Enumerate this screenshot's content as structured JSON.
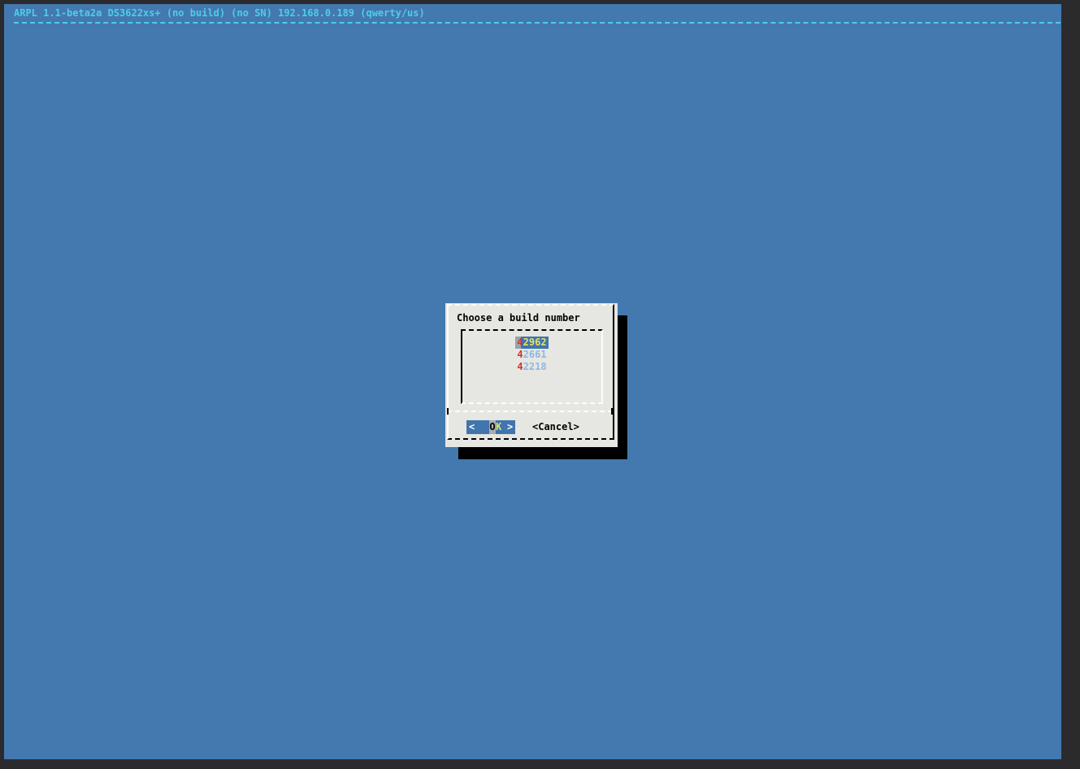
{
  "terminal": {
    "backtitle": "ARPL 1.1-beta2a DS3622xs+ (no build) (no SN) 192.168.0.189 (qwerty/us)"
  },
  "dialog": {
    "title": "Choose a build number",
    "items": [
      {
        "hotkey": "4",
        "rest": "2962",
        "selected": true
      },
      {
        "hotkey": "4",
        "rest": "2661",
        "selected": false
      },
      {
        "hotkey": "4",
        "rest": "2218",
        "selected": false
      }
    ],
    "buttons": {
      "ok": {
        "bracket_left": "<",
        "cursor_char": "O",
        "label_rest": "K",
        "bracket_right": ">"
      },
      "cancel": {
        "text": "<Cancel>"
      }
    }
  },
  "colors": {
    "frame_dark": "#2b2b2d",
    "screen_blue": "#4379af",
    "backtitle_cyan": "#4ecde6",
    "dialog_bg": "#e6e6e2",
    "shadow": "#000000",
    "hotkey_red": "#d2342a",
    "selected_item_bg": "#4075ad",
    "selected_item_yellow": "#e9e160",
    "unselected_item_blue": "#8cb8e4",
    "cursor_gray": "#a8aeb2",
    "button_bracket_white": "#ffffff"
  }
}
